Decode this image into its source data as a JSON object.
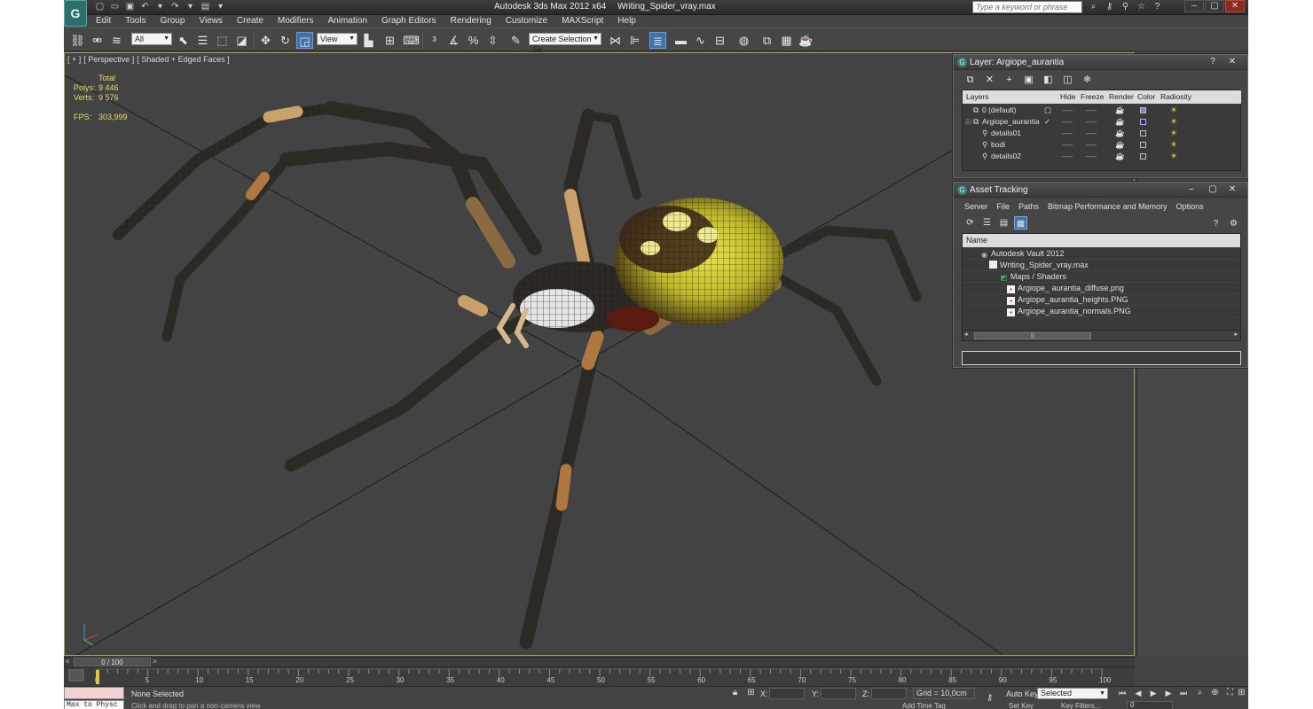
{
  "window": {
    "app_name": "Autodesk 3ds Max  2012 x64",
    "file_name": "Writing_Spider_vray.max",
    "search_placeholder": "Type a keyword or phrase"
  },
  "menu": [
    "Edit",
    "Tools",
    "Group",
    "Views",
    "Create",
    "Modifiers",
    "Animation",
    "Graph Editors",
    "Rendering",
    "Customize",
    "MAXScript",
    "Help"
  ],
  "toolbar": {
    "selection_filter": "All",
    "ref_coord": "View",
    "named_selection": "Create Selection Se"
  },
  "viewport": {
    "label_plus": "[ + ]",
    "label_view": "[ Perspective ]",
    "label_shading": "[ Shaded + Edged Faces ]",
    "stats_header": "Total",
    "polys_label": "Polys:",
    "polys_value": "9 446",
    "verts_label": "Verts:",
    "verts_value": "9 576",
    "fps_label": "FPS:",
    "fps_value": "303,999"
  },
  "layer_dialog": {
    "title": "Layer: Argiope_aurantia",
    "columns": [
      "Layers",
      "Hide",
      "Freeze",
      "Render",
      "Color",
      "Radiosity"
    ],
    "rows": [
      {
        "name": "0 (default)",
        "color": "#8a7cc8"
      },
      {
        "name": "Argiope_aurantia",
        "color": "#3a1aa0"
      },
      {
        "name": "details01",
        "color": "#404040"
      },
      {
        "name": "bodi",
        "color": "#404040"
      },
      {
        "name": "details02",
        "color": "#404040"
      }
    ]
  },
  "asset_dialog": {
    "title": "Asset Tracking",
    "menu": [
      "Server",
      "File",
      "Paths",
      "Bitmap Performance and Memory",
      "Options"
    ],
    "column_name": "Name",
    "items": [
      {
        "label": "Autodesk Vault 2012",
        "icon": "vault-icon"
      },
      {
        "label": "Writing_Spider_vray.max",
        "icon": "file-icon"
      },
      {
        "label": "Maps / Shaders",
        "icon": "maps-icon"
      },
      {
        "label": "Argiope_ aurantia_diffuse.png",
        "icon": "bitmap-icon"
      },
      {
        "label": "Argiope_aurantia_heights.PNG",
        "icon": "bitmap-icon"
      },
      {
        "label": "Argiope_aurantia_normals.PNG",
        "icon": "bitmap-icon"
      }
    ]
  },
  "timeline": {
    "frame_display": "0 / 100",
    "tick_labels": [
      "0",
      "5",
      "10",
      "15",
      "20",
      "25",
      "30",
      "35",
      "40",
      "45",
      "50",
      "55",
      "60",
      "65",
      "70",
      "75",
      "80",
      "85",
      "90",
      "95",
      "100"
    ]
  },
  "status": {
    "maxscript_text": "Max to Physc",
    "selection": "None Selected",
    "prompt": "Click and drag to pan a non-camera view",
    "x_label": "X:",
    "y_label": "Y:",
    "z_label": "Z:",
    "grid": "Grid = 10,0cm",
    "auto_key": "Auto Key",
    "set_key": "Set Key",
    "key_mode": "Selected",
    "key_filters": "Key Filters...",
    "add_time_tag": "Add Time Tag",
    "frame": "0"
  },
  "colors": {
    "app_bg": "#444444",
    "viewport_border": "#a8a060",
    "stats_yellow": "#e6dc6a",
    "active_blue": "#3f72a8"
  }
}
